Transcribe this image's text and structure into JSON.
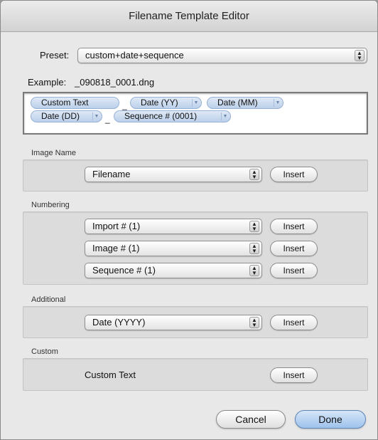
{
  "window": {
    "title": "Filename Template Editor"
  },
  "preset": {
    "label": "Preset:",
    "value": "custom+date+sequence"
  },
  "example": {
    "label": "Example:",
    "value": "_090818_0001.dng"
  },
  "template": {
    "tokens": [
      "Custom Text",
      "Date (YY)",
      "Date (MM)",
      "Date (DD)",
      "Sequence # (0001)"
    ],
    "separators": [
      "_",
      "_"
    ]
  },
  "image_name": {
    "title": "Image Name",
    "select": "Filename",
    "insert": "Insert"
  },
  "numbering": {
    "title": "Numbering",
    "rows": [
      {
        "select": "Import # (1)",
        "insert": "Insert"
      },
      {
        "select": "Image # (1)",
        "insert": "Insert"
      },
      {
        "select": "Sequence # (1)",
        "insert": "Insert"
      }
    ]
  },
  "additional": {
    "title": "Additional",
    "select": "Date (YYYY)",
    "insert": "Insert"
  },
  "custom": {
    "title": "Custom",
    "text": "Custom Text",
    "insert": "Insert"
  },
  "footer": {
    "cancel": "Cancel",
    "done": "Done"
  },
  "colors": {
    "token_fill": "#c9dbf0",
    "default_button": "#9ec2ec"
  }
}
